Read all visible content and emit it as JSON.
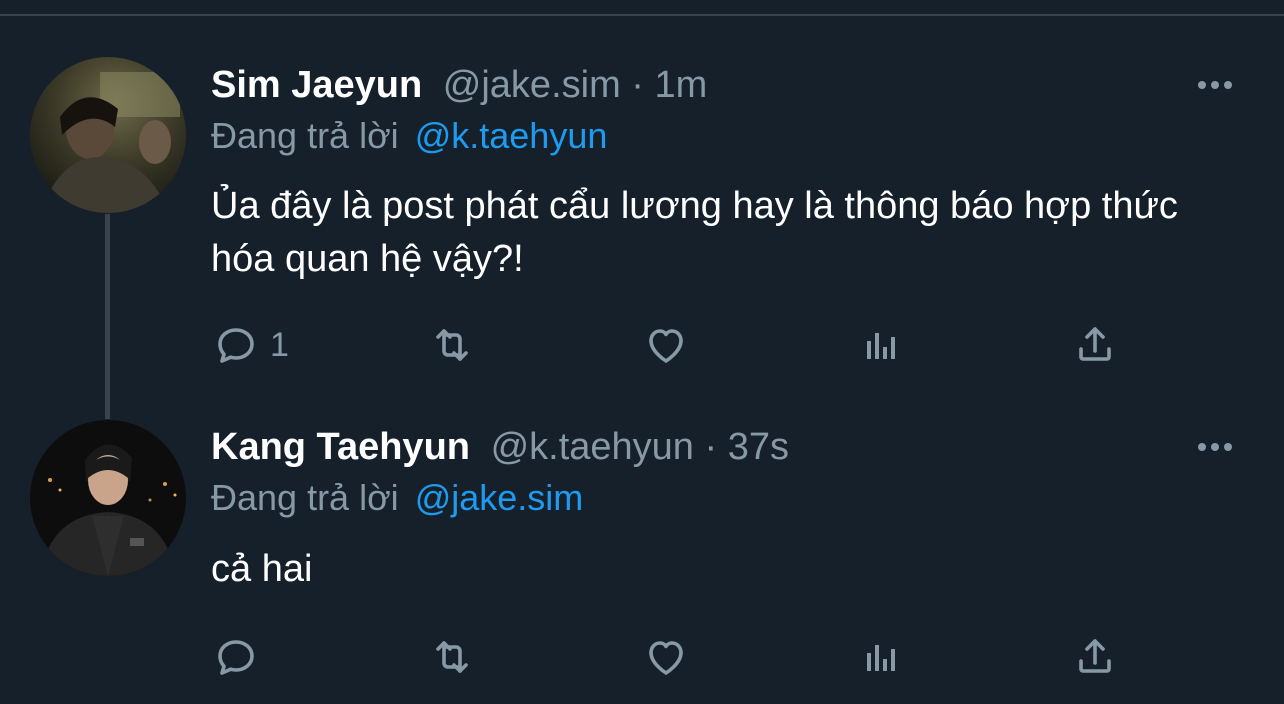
{
  "colors": {
    "background": "#15202b",
    "divider": "#38444d",
    "secondary_text": "#8899a6",
    "mention": "#1d9bf0",
    "primary_text": "#ffffff"
  },
  "tweets": [
    {
      "name": "Sim Jaeyun",
      "handle": "@jake.sim",
      "separator": "·",
      "time": "1m",
      "reply_prefix": "Đang trả lời",
      "reply_to": "@k.taehyun",
      "text": "Ủa đây là post phát cẩu lương hay là thông báo hợp thức hóa quan hệ vậy?!",
      "reply_count": "1",
      "icons": [
        "reply-icon",
        "retweet-icon",
        "like-icon",
        "analytics-icon",
        "share-icon",
        "more-icon"
      ]
    },
    {
      "name": "Kang Taehyun",
      "handle": "@k.taehyun",
      "separator": "·",
      "time": "37s",
      "reply_prefix": "Đang trả lời",
      "reply_to": "@jake.sim",
      "text": "cả hai",
      "reply_count": "",
      "icons": [
        "reply-icon",
        "retweet-icon",
        "like-icon",
        "analytics-icon",
        "share-icon",
        "more-icon"
      ]
    }
  ]
}
